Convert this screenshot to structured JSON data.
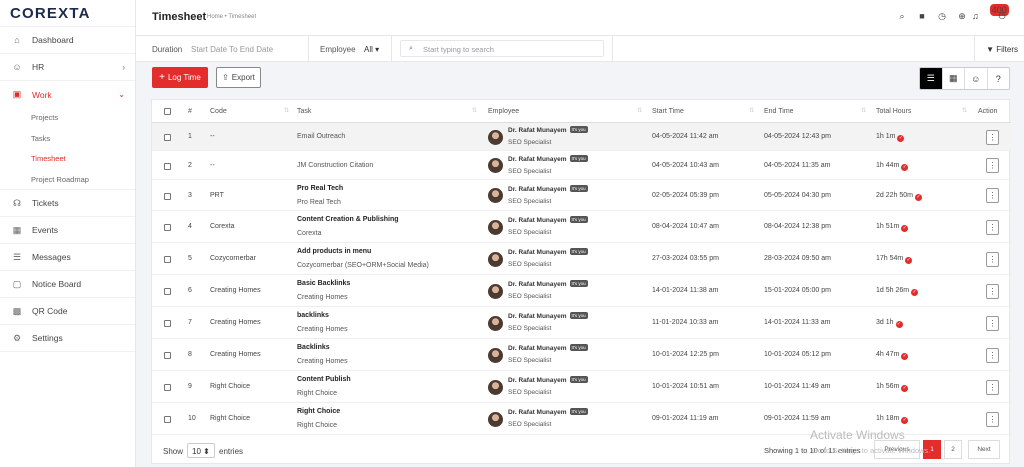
{
  "brand": "COREXTA",
  "sidebar": {
    "items": [
      {
        "label": "Dashboard",
        "icon": "home-icon"
      },
      {
        "label": "HR",
        "icon": "users-icon"
      },
      {
        "label": "Work",
        "icon": "briefcase-icon"
      },
      {
        "label": "Tickets",
        "icon": "headset-icon"
      },
      {
        "label": "Events",
        "icon": "calendar-icon"
      },
      {
        "label": "Messages",
        "icon": "chat-icon"
      },
      {
        "label": "Notice Board",
        "icon": "board-icon"
      },
      {
        "label": "QR Code",
        "icon": "qr-icon"
      },
      {
        "label": "Settings",
        "icon": "gear-icon"
      }
    ],
    "work_sub": [
      "Projects",
      "Tasks",
      "Timesheet",
      "Project Roadmap"
    ]
  },
  "header": {
    "title": "Timesheet",
    "breadcrumb": "Home • Timesheet",
    "notification_count": "400"
  },
  "filters": {
    "duration_label": "Duration",
    "duration_placeholder": "Start Date To End Date",
    "employee_label": "Employee",
    "employee_value": "All",
    "search_placeholder": "Start typing to search",
    "filters_label": "Filters"
  },
  "actions": {
    "log_time": "Log Time",
    "export": "Export"
  },
  "table": {
    "columns": [
      "#",
      "Code",
      "Task",
      "Employee",
      "Start Time",
      "End Time",
      "Total Hours",
      "Action"
    ],
    "rows": [
      {
        "num": "1",
        "code": "--",
        "task": "",
        "project": "Email Outreach",
        "employee": "Dr. Rafat Munayem",
        "tag": "It's you",
        "role": "SEO Specialist",
        "start": "04-05-2024 11:42 am",
        "end": "04-05-2024 12:43 pm",
        "hours": "1h 1m"
      },
      {
        "num": "2",
        "code": "--",
        "task": "",
        "project": "JM Construction Citation",
        "employee": "Dr. Rafat Munayem",
        "tag": "It's you",
        "role": "SEO Specialist",
        "start": "04-05-2024 10:43 am",
        "end": "04-05-2024 11:35 am",
        "hours": "1h 44m"
      },
      {
        "num": "3",
        "code": "PRT",
        "task": "Pro Real Tech",
        "project": "Pro Real Tech",
        "employee": "Dr. Rafat Munayem",
        "tag": "It's you",
        "role": "SEO Specialist",
        "start": "02-05-2024 05:39 pm",
        "end": "05-05-2024 04:30 pm",
        "hours": "2d 22h 50m"
      },
      {
        "num": "4",
        "code": "Corexta",
        "task": "Content Creation & Publishing",
        "project": "Corexta",
        "employee": "Dr. Rafat Munayem",
        "tag": "It's you",
        "role": "SEO Specialist",
        "start": "08-04-2024 10:47 am",
        "end": "08-04-2024 12:38 pm",
        "hours": "1h 51m"
      },
      {
        "num": "5",
        "code": "Cozycornerbar",
        "task": "Add products in menu",
        "project": "Cozycornerbar (SEO+ORM+Social Media)",
        "employee": "Dr. Rafat Munayem",
        "tag": "It's you",
        "role": "SEO Specialist",
        "start": "27-03-2024 03:55 pm",
        "end": "28-03-2024 09:50 am",
        "hours": "17h 54m"
      },
      {
        "num": "6",
        "code": "Creating Homes",
        "task": "Basic Backlinks",
        "project": "Creating Homes",
        "employee": "Dr. Rafat Munayem",
        "tag": "It's you",
        "role": "SEO Specialist",
        "start": "14-01-2024 11:38 am",
        "end": "15-01-2024 05:00 pm",
        "hours": "1d 5h 26m"
      },
      {
        "num": "7",
        "code": "Creating Homes",
        "task": "backlinks",
        "project": "Creating Homes",
        "employee": "Dr. Rafat Munayem",
        "tag": "It's you",
        "role": "SEO Specialist",
        "start": "11-01-2024 10:33 am",
        "end": "14-01-2024 11:33 am",
        "hours": "3d 1h"
      },
      {
        "num": "8",
        "code": "Creating Homes",
        "task": "Backlinks",
        "project": "Creating Homes",
        "employee": "Dr. Rafat Munayem",
        "tag": "It's you",
        "role": "SEO Specialist",
        "start": "10-01-2024 12:25 pm",
        "end": "10-01-2024 05:12 pm",
        "hours": "4h 47m"
      },
      {
        "num": "9",
        "code": "Right Choice",
        "task": "Content Publish",
        "project": "Right Choice",
        "employee": "Dr. Rafat Munayem",
        "tag": "It's you",
        "role": "SEO Specialist",
        "start": "10-01-2024 10:51 am",
        "end": "10-01-2024 11:49 am",
        "hours": "1h 56m"
      },
      {
        "num": "10",
        "code": "Right Choice",
        "task": "Right Choice",
        "project": "Right Choice",
        "employee": "Dr. Rafat Munayem",
        "tag": "It's you",
        "role": "SEO Specialist",
        "start": "09-01-2024 11:19 am",
        "end": "09-01-2024 11:59 am",
        "hours": "1h 18m"
      }
    ]
  },
  "footer": {
    "show_label": "Show",
    "page_size": "10",
    "entries_label": "entries",
    "showing": "Showing 1 to 10 of 11 entries",
    "prev": "Previous",
    "pages": [
      "1",
      "2"
    ],
    "next": "Next"
  },
  "watermark": {
    "line1": "Activate Windows",
    "line2": "Go to Settings to activate Windows."
  },
  "colors": {
    "accent": "#e32c2c",
    "text": "#333333"
  }
}
